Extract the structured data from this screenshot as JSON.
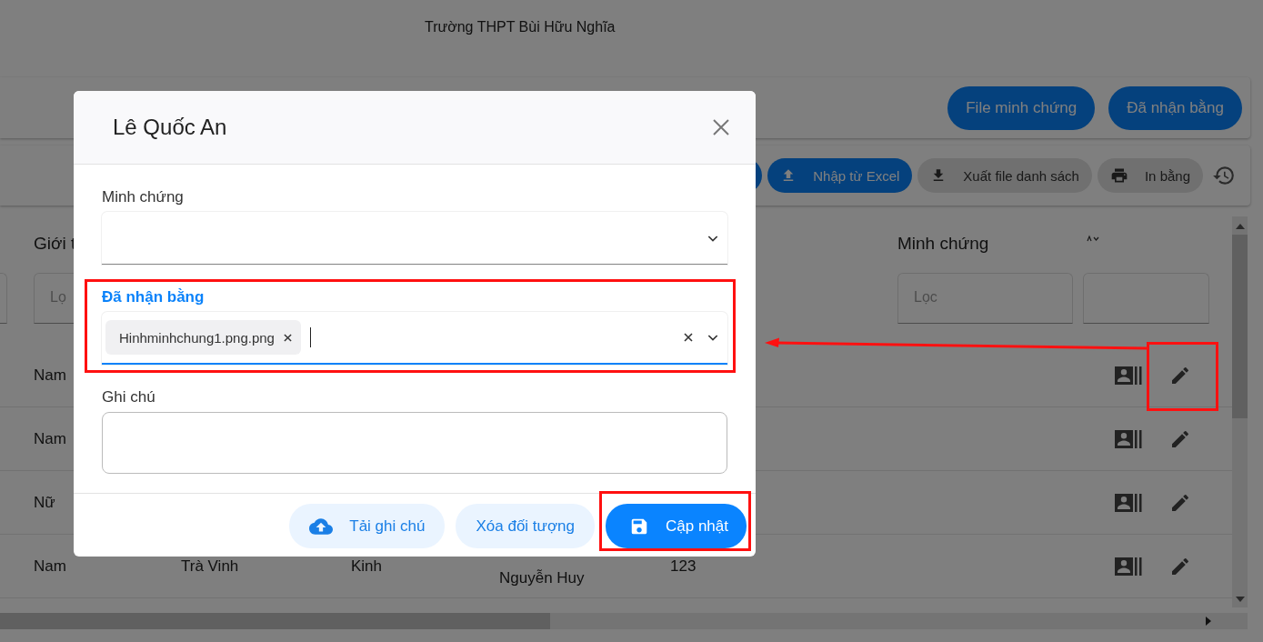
{
  "header": {
    "title": "Trường THPT Bùi Hữu Nghĩa"
  },
  "top_actions": [
    {
      "label": "File minh chứng"
    },
    {
      "label": "Đã nhận bằng"
    }
  ],
  "toolbar": [
    {
      "kind": "primary"
    },
    {
      "kind": "primary",
      "label": "Nhập từ Excel"
    },
    {
      "kind": "secondary",
      "label": "Xuất file danh sách"
    },
    {
      "kind": "secondary",
      "label": "In bằng"
    }
  ],
  "table": {
    "columns": [
      "Giới t",
      "Minh chứng"
    ],
    "filters": [
      "Lọ",
      "Lọc"
    ],
    "rows": [
      {
        "cells": [
          "Nam"
        ]
      },
      {
        "cells": [
          "Nam"
        ]
      },
      {
        "cells": [
          "Nữ"
        ]
      },
      {
        "cells": [
          "Nam",
          "Trà Vinh",
          "Kinh",
          "Nguyễn Huy",
          "123"
        ]
      }
    ]
  },
  "dialog": {
    "title": "Lê Quốc An",
    "fields": [
      {
        "kind": "select",
        "label": "Minh chứng",
        "focused": false
      },
      {
        "kind": "tags",
        "label": "Đã nhận bằng",
        "focused": true,
        "tags": [
          "Hinhminhchung1.png.png"
        ]
      },
      {
        "kind": "textarea",
        "label": "Ghi chú",
        "focused": false
      }
    ],
    "buttons": [
      {
        "kind": "secondary",
        "label": "Tải ghi chú"
      },
      {
        "kind": "secondary",
        "label": "Xóa đối tượng"
      },
      {
        "kind": "primary",
        "label": "Cập nhật"
      }
    ]
  }
}
